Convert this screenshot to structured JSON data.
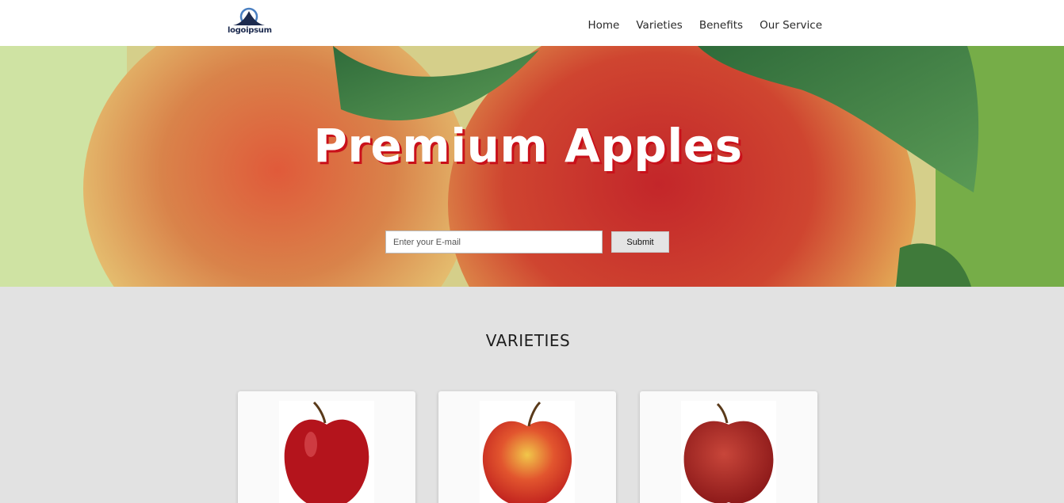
{
  "header": {
    "logo_text": "logoipsum",
    "nav": [
      "Home",
      "Varieties",
      "Benefits",
      "Our Service"
    ]
  },
  "hero": {
    "title": "Premium Apples",
    "email_placeholder": "Enter your E-mail",
    "submit_label": "Submit"
  },
  "varieties": {
    "title": "VARIETIES"
  },
  "colors": {
    "title_shadow": "#c9101a",
    "section_bg": "#e2e2e2",
    "logo_blue": "#4a7fc1",
    "logo_navy": "#1d2b4f"
  }
}
